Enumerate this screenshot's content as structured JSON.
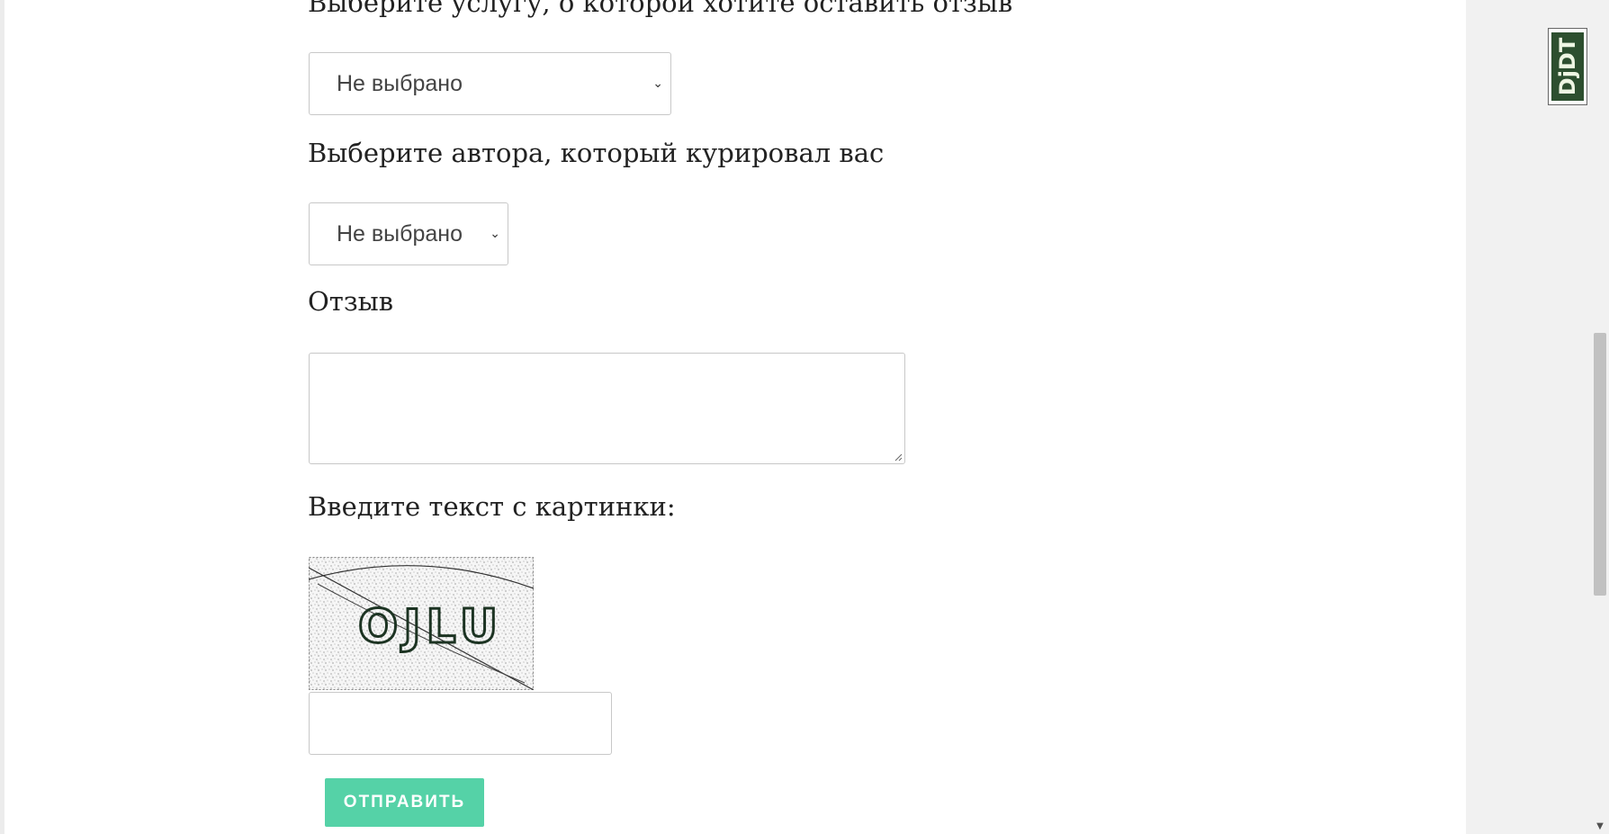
{
  "form": {
    "service_label": "Выберите услугу, о которой хотите оставить отзыв",
    "service_select_value": "Не выбрано",
    "author_label": "Выберите автора, который курировал вас",
    "author_select_value": "Не выбрано",
    "review_label": "Отзыв",
    "review_value": "",
    "captcha_label": "Введите текст с картинки:",
    "captcha_image_text": "OJLU",
    "captcha_input_value": "",
    "submit_label": "ОТПРАВИТЬ"
  },
  "debug_toolbar": {
    "handle_label": "DjDT"
  },
  "colors": {
    "submit_button": "#55d2a7",
    "toolbar_handle": "#2d4f2f"
  }
}
